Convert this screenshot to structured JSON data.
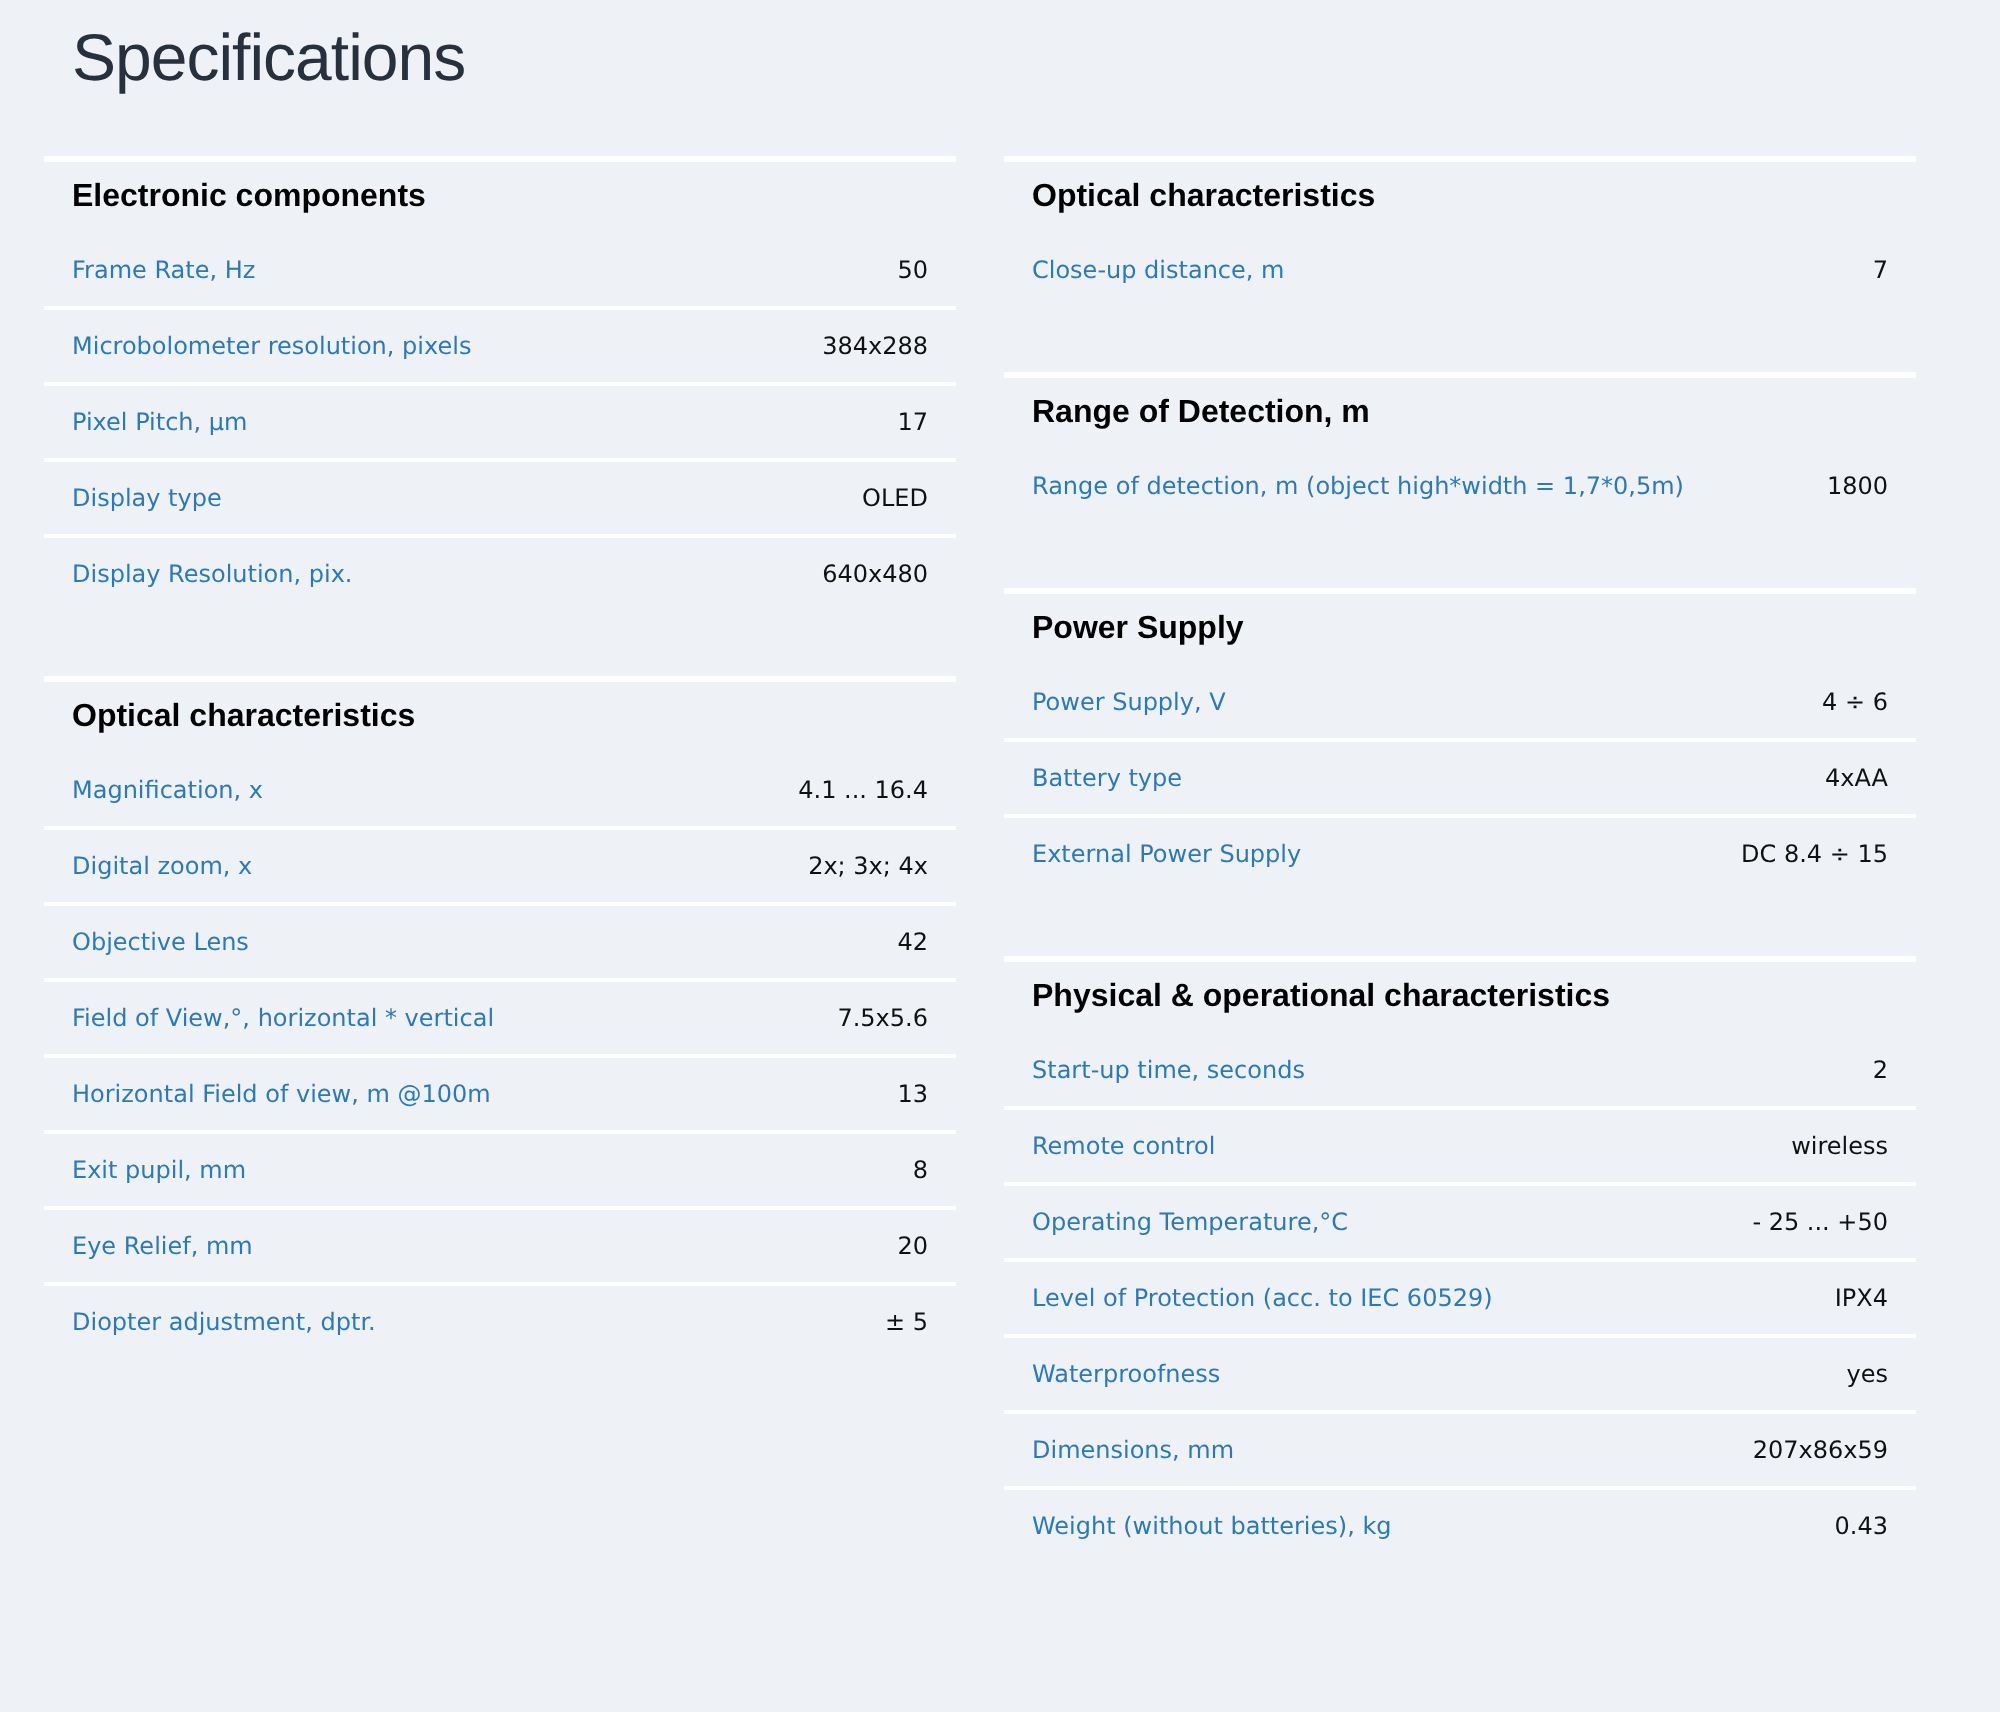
{
  "title": "Specifications",
  "columns": [
    {
      "sections": [
        {
          "title": "Electronic components",
          "rows": [
            {
              "label": "Frame Rate, Hz",
              "value": "50"
            },
            {
              "label": "Microbolometer resolution, pixels",
              "value": "384x288"
            },
            {
              "label": "Pixel Pitch, µm",
              "value": "17"
            },
            {
              "label": "Display type",
              "value": "OLED"
            },
            {
              "label": "Display Resolution, pix.",
              "value": "640x480"
            }
          ]
        },
        {
          "title": "Optical characteristics",
          "rows": [
            {
              "label": "Magnification, x",
              "value": "4.1 ... 16.4"
            },
            {
              "label": "Digital zoom, x",
              "value": "2x; 3x; 4x"
            },
            {
              "label": "Objective Lens",
              "value": "42"
            },
            {
              "label": "Field of View,°, horizontal * vertical",
              "value": "7.5x5.6"
            },
            {
              "label": "Horizontal Field of view, m @100m",
              "value": "13"
            },
            {
              "label": "Exit pupil, mm",
              "value": "8"
            },
            {
              "label": "Eye Relief, mm",
              "value": "20"
            },
            {
              "label": "Diopter adjustment, dptr.",
              "value": "± 5"
            }
          ]
        }
      ]
    },
    {
      "sections": [
        {
          "title": "Optical characteristics",
          "rows": [
            {
              "label": "Close-up distance, m",
              "value": "7"
            }
          ]
        },
        {
          "title": "Range of Detection, m",
          "rows": [
            {
              "label": "Range of detection, m (object high*width = 1,7*0,5m)",
              "value": "1800"
            }
          ]
        },
        {
          "title": "Power Supply",
          "rows": [
            {
              "label": "Power Supply, V",
              "value": "4 ÷ 6"
            },
            {
              "label": "Battery type",
              "value": "4xAA"
            },
            {
              "label": "External Power Supply",
              "value": "DC 8.4 ÷ 15"
            }
          ]
        },
        {
          "title": "Physical & operational characteristics",
          "rows": [
            {
              "label": "Start-up time, seconds",
              "value": "2"
            },
            {
              "label": "Remote control",
              "value": "wireless"
            },
            {
              "label": "Operating Temperature,°C",
              "value": "- 25 ... +50"
            },
            {
              "label": "Level of Protection (acc. to IEC 60529)",
              "value": "IPX4"
            },
            {
              "label": "Waterproofness",
              "value": "yes"
            },
            {
              "label": "Dimensions, mm",
              "value": "207x86x59"
            },
            {
              "label": "Weight (without batteries), kg",
              "value": "0.43"
            }
          ]
        }
      ]
    }
  ]
}
